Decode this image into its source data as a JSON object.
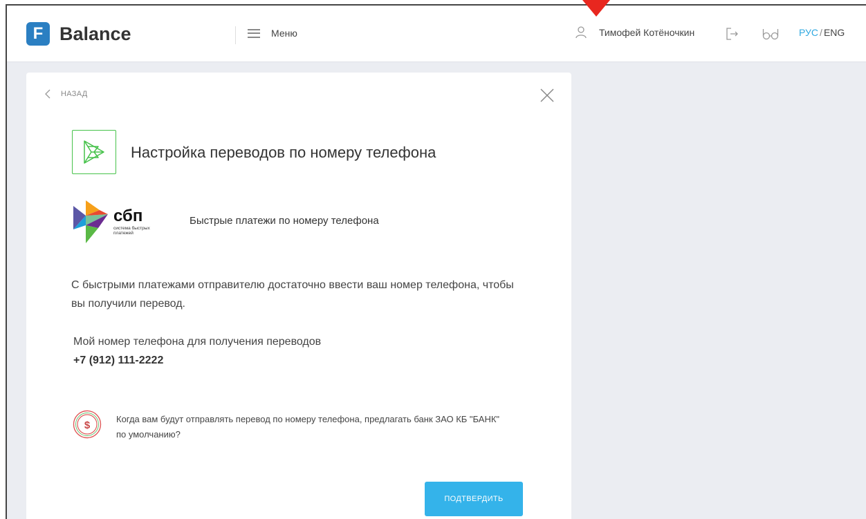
{
  "header": {
    "logo_letter": "F",
    "logo_text": "Balance",
    "menu_label": "Меню",
    "user_name": "Тимофей Котёночкин",
    "lang_active": "РУС",
    "lang_separator": "/",
    "lang_inactive": "ENG"
  },
  "card": {
    "back_label": "НАЗАД",
    "title": "Настройка переводов по номеру телефона",
    "sbp_logo_text": "сбп",
    "sbp_logo_subtext_1": "система быстрых",
    "sbp_logo_subtext_2": "платежей",
    "sbp_caption": "Быстрые платежи по номеру телефона",
    "description": "С быстрыми платежами отправителю достаточно ввести ваш номер телефона, чтобы вы получили перевод.",
    "phone_label": "Мой номер телефона для получения переводов",
    "phone_value": "+7 (912) 111-2222",
    "notice": "Когда вам будут отправлять перевод по номеру телефона, предлагать банк ЗАО КБ \"БАНК\" по умолчанию?",
    "confirm_label": "ПОДТВЕРДИТЬ"
  },
  "colors": {
    "accent": "#34b3ea",
    "brand": "#2b7fc2",
    "lang_active": "#2fa8e0",
    "sbp_green": "#46c24a",
    "annotation_arrow": "#e8271f"
  },
  "icons": [
    "logo-mark-icon",
    "menu-burger-icon",
    "user-icon",
    "logout-icon",
    "glasses-icon",
    "back-chevron-icon",
    "close-icon",
    "sbp-transfer-icon",
    "sbp-logo",
    "dollar-coin-icon"
  ]
}
